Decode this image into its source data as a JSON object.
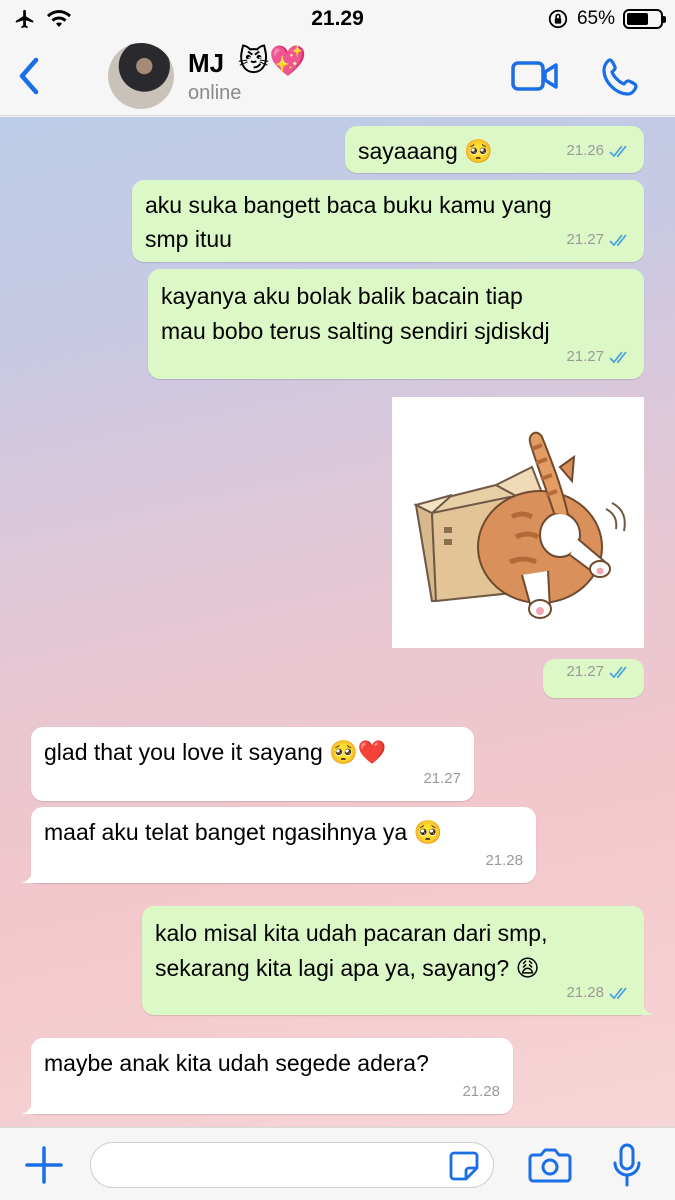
{
  "status_bar": {
    "time": "21.29",
    "battery": "65%",
    "battery_level": 0.65
  },
  "header": {
    "contact_name": "MJ",
    "contact_emoji": "😼💖",
    "contact_status": "online",
    "icons": [
      "back-chevron-icon",
      "video-call-icon",
      "phone-icon"
    ]
  },
  "messages": [
    {
      "direction": "out",
      "text": "sayaaang 🥺",
      "time": "21.26",
      "read": true
    },
    {
      "direction": "out",
      "text": "aku suka bangett baca buku kamu yang\nsmp ituu",
      "time": "21.27",
      "read": true
    },
    {
      "direction": "out",
      "text": "kayanya aku bolak balik bacain tiap\nmau bobo terus salting sendiri sjdiskdj",
      "time": "21.27",
      "read": true
    },
    {
      "direction": "out",
      "type": "sticker",
      "sticker": "cat-in-box",
      "time": "21.27",
      "read": true
    },
    {
      "direction": "in",
      "text": "glad that you love it sayang 🥺❤️",
      "time": "21.27"
    },
    {
      "direction": "in",
      "text": "maaf aku telat banget ngasihnya ya 🥺",
      "time": "21.28"
    },
    {
      "direction": "out",
      "text": "kalo misal kita udah pacaran dari smp,\nsekarang kita lagi apa ya, sayang? 😩",
      "time": "21.28",
      "read": true
    },
    {
      "direction": "in",
      "text": "maybe anak kita udah segede adera?",
      "time": "21.28"
    }
  ],
  "input": {
    "placeholder": "",
    "value": ""
  },
  "colors": {
    "accent": "#1a6ee6",
    "outgoing_bubble": "#dcf8c6",
    "incoming_bubble": "#ffffff",
    "read_ticks": "#4fa3e0"
  }
}
